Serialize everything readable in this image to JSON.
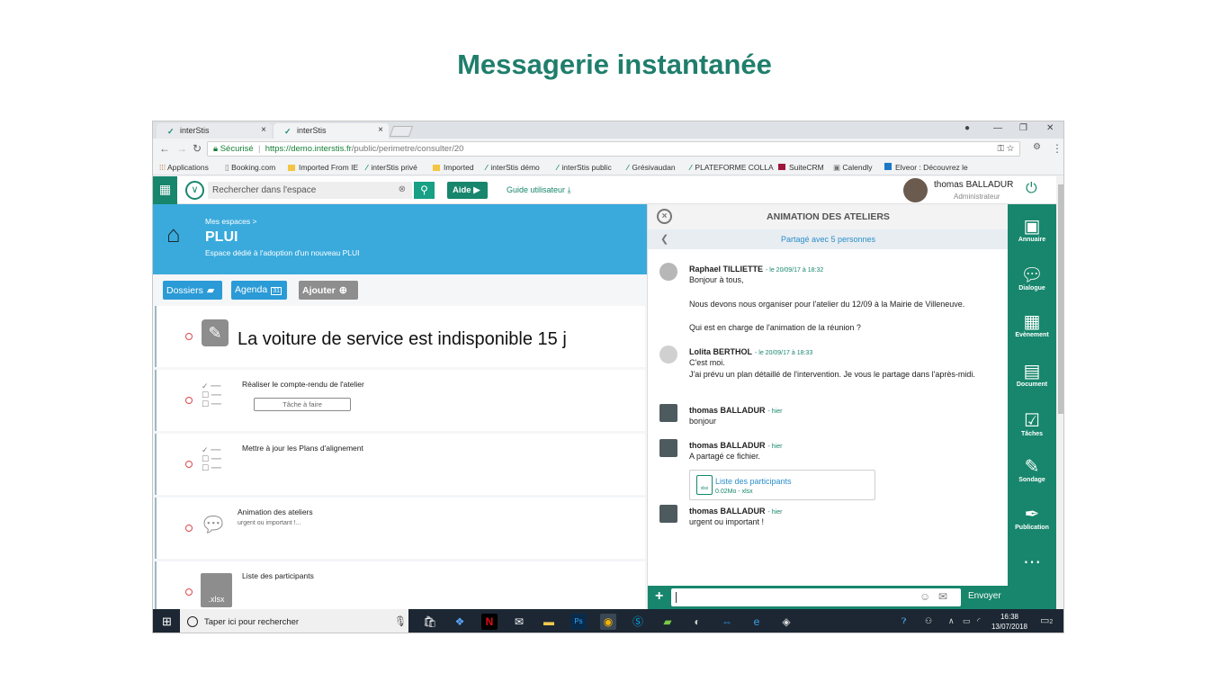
{
  "slide": {
    "title": "Messagerie instantanée"
  },
  "browser": {
    "tabs": [
      {
        "label": "interStis",
        "close": "×"
      },
      {
        "label": "interStis",
        "close": "×"
      }
    ],
    "secure_label": "Sécurisé",
    "url_host": "https://demo.interstis.fr",
    "url_path": "/public/perimetre/consulter/20",
    "bookmarks": [
      "Applications",
      "Booking.com",
      "Imported From IE",
      "interStis privé",
      "Imported",
      "interStis démo",
      "interStis public",
      "Grésivaudan",
      "PLATEFORME COLLA",
      "SuiteCRM",
      "Calendly",
      "Elveor : Découvrez le"
    ]
  },
  "app": {
    "search_placeholder": "Rechercher dans  l'espace",
    "help_label": "Aide",
    "guide_label": "Guide utilisateur",
    "user_name": "thomas BALLADUR",
    "user_role": "Administrateur"
  },
  "space": {
    "breadcrumb": "Mes espaces >",
    "title": "PLUI",
    "subtitle": "Espace dédié à l'adoption d'un nouveau PLUI",
    "buttons": [
      "Dossiers",
      "Agenda",
      "Ajouter"
    ],
    "agenda_day": "31"
  },
  "feed": {
    "note_text": "La voiture de service est indisponible 15 j",
    "task1_title": "Réaliser le compte-rendu de l'atelier",
    "task1_button": "Tâche à faire",
    "task2_title": "Mettre à jour les Plans d'alignement",
    "dialog_title": "Animation des ateliers",
    "dialog_sub": "urgent ou important !...",
    "file_title": "Liste des participants",
    "file_ext": ".xlsx"
  },
  "chat": {
    "title": "ANIMATION DES ATELIERS",
    "shared": "Partagé avec 5 personnes",
    "messages": [
      {
        "author": "Raphael TILLIETTE",
        "time": "- le 20/09/17 à 18:32",
        "lines": [
          "Bonjour à tous,",
          "Nous devons nous organiser pour l'atelier du 12/09 à la Mairie de Villeneuve.",
          "Qui est en charge de l'animation de la réunion ?"
        ]
      },
      {
        "author": "Lolita BERTHOL",
        "time": "- le 20/09/17 à 18:33",
        "lines": [
          "C'est moi.",
          "J'ai prévu un plan détaillé de l'intervention. Je vous le partage dans l'après-midi."
        ]
      },
      {
        "author": "thomas BALLADUR",
        "time": "- hier",
        "lines": [
          "bonjour"
        ]
      },
      {
        "author": "thomas BALLADUR",
        "time": "- hier",
        "lines": [
          "A partagé ce fichier."
        ],
        "file": {
          "name": "Liste des participants",
          "meta": "0.02Mo - xlsx",
          "badge": "xlsx"
        }
      },
      {
        "author": "thomas BALLADUR",
        "time": "- hier",
        "lines": [
          "urgent ou important !"
        ]
      }
    ],
    "send_label": "Envoyer"
  },
  "rail": [
    {
      "label": "Annuaire",
      "icon": "contacts-icon"
    },
    {
      "label": "Dialogue",
      "icon": "chat-icon"
    },
    {
      "label": "Evènement",
      "icon": "calendar-icon"
    },
    {
      "label": "Document",
      "icon": "document-icon"
    },
    {
      "label": "Tâches",
      "icon": "tasks-icon"
    },
    {
      "label": "Sondage",
      "icon": "poll-icon"
    },
    {
      "label": "Publication",
      "icon": "pen-icon"
    },
    {
      "label": "",
      "icon": "more-icon"
    }
  ],
  "taskbar": {
    "search_placeholder": "Taper ici pour rechercher",
    "time": "16:38",
    "date": "13/07/2018",
    "notifications": "2"
  },
  "colors": {
    "brand_green": "#17866c",
    "banner_blue": "#3aaadd",
    "title_teal": "#1f7e6c"
  }
}
